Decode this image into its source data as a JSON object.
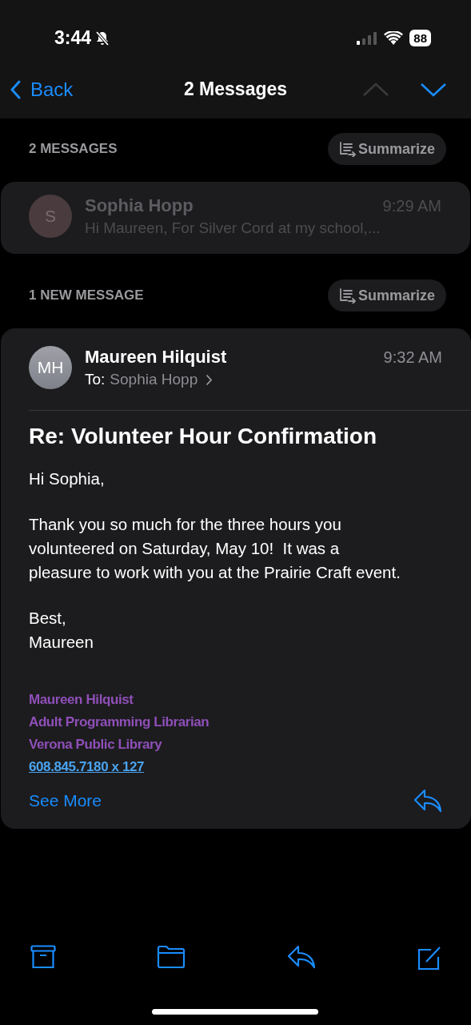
{
  "status_bar": {
    "time": "3:44",
    "silent": true,
    "battery": "88"
  },
  "nav": {
    "back": "Back",
    "title": "2 Messages",
    "previous": {
      "disabled": true
    },
    "next": {
      "disabled": false
    }
  },
  "sections": [
    {
      "heading": "2 MESSAGES",
      "summarize": "Summarize",
      "messages": [
        {
          "kind": "collapsed",
          "initials": "S",
          "sender": "Sophia Hopp",
          "time": "9:29 AM",
          "preview": "Hi Maureen, For Silver Cord at my school,..."
        }
      ]
    },
    {
      "heading": "1 NEW MESSAGE",
      "summarize": "Summarize",
      "messages": [
        {
          "kind": "expanded",
          "initials": "MH",
          "sender": "Maureen Hilquist",
          "time": "9:32 AM",
          "to_label": "To:",
          "to": "Sophia Hopp",
          "subject": "Re: Volunteer Hour Confirmation",
          "body": [
            "Hi Sophia,",
            "Thank you so much for the three hours you volunteered on Saturday, May 10!  It was a pleasure to work with you at the Prairie Craft event.",
            "Best,\nMaureen"
          ],
          "signature": [
            "Maureen Hilquist",
            "Adult Programming Librarian",
            "Verona Public Library"
          ],
          "phone": "608.845.7180 x 127",
          "see_more": "See More"
        }
      ]
    }
  ]
}
